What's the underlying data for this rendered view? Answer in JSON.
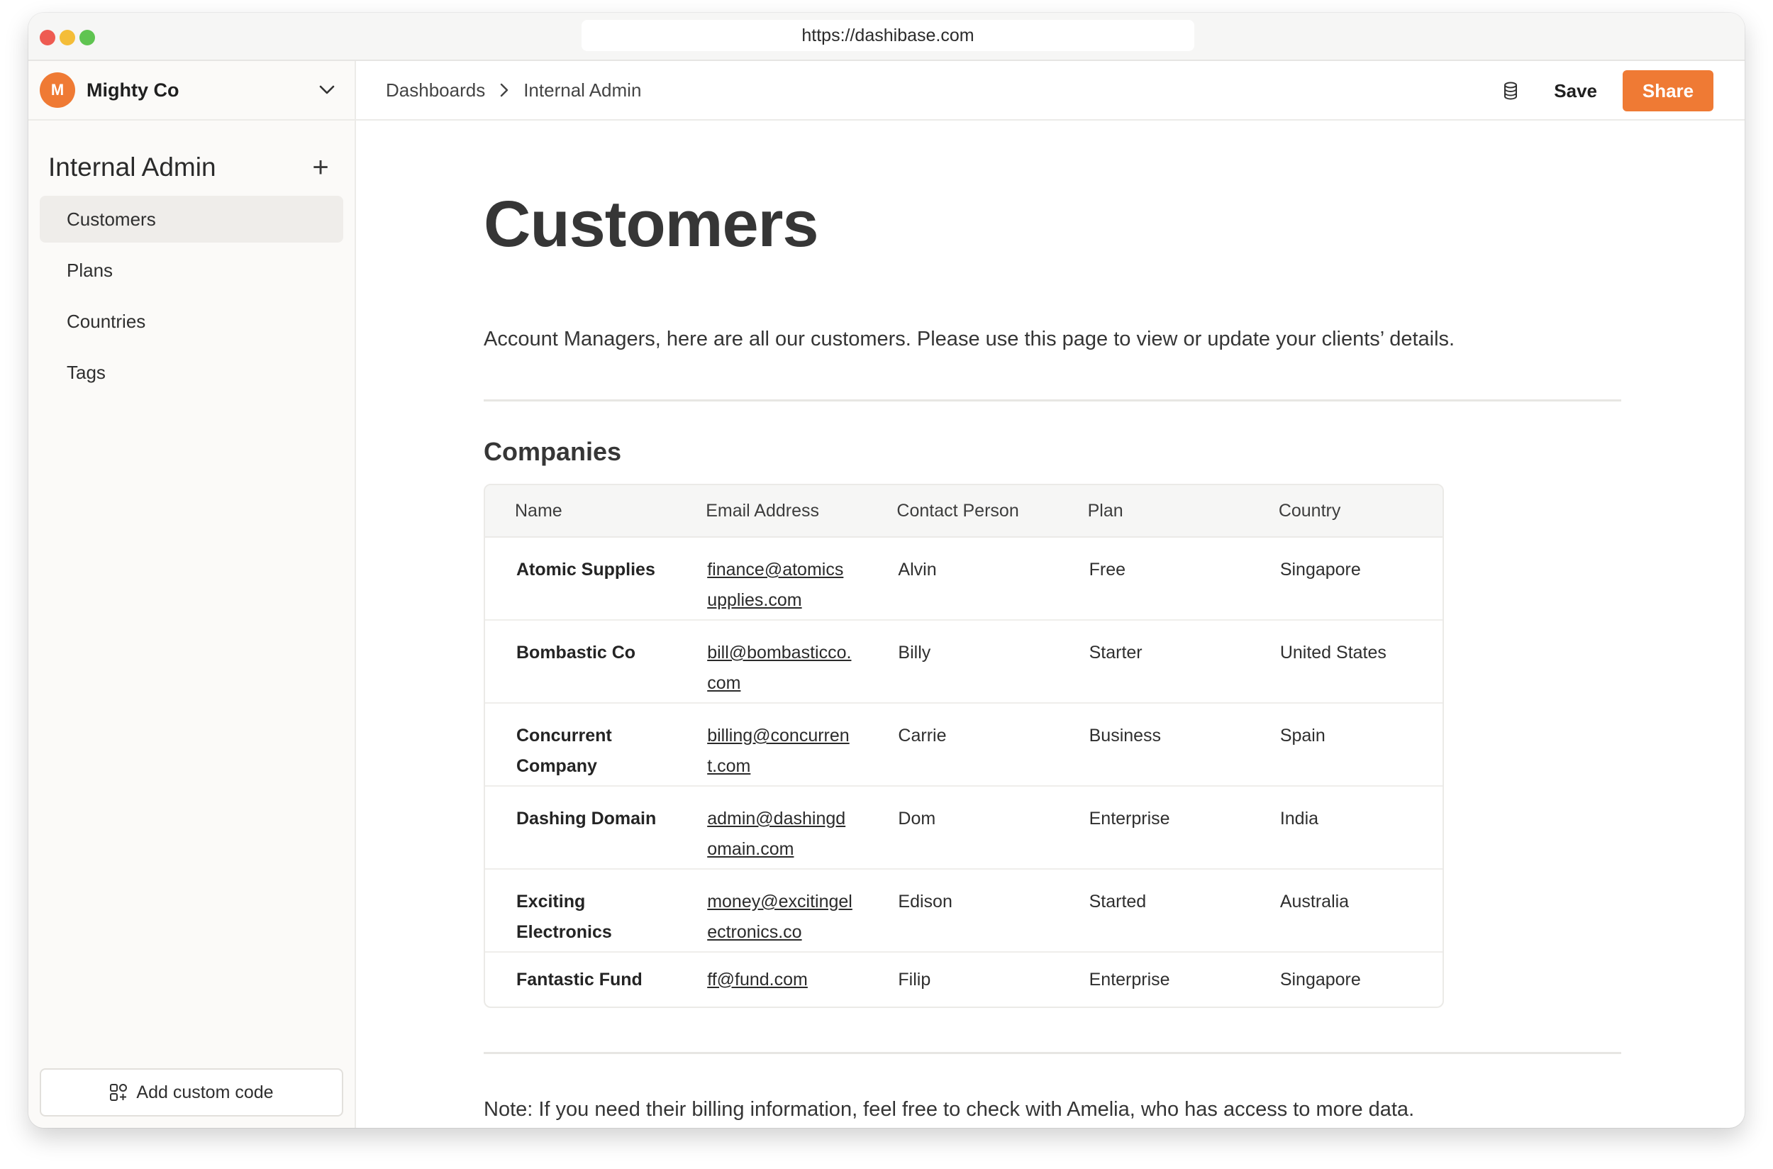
{
  "browser": {
    "url": "https://dashibase.com"
  },
  "workspace": {
    "avatar_letter": "M",
    "name": "Mighty Co",
    "accent": "#ef7a34"
  },
  "sidebar": {
    "title": "Internal Admin",
    "items": [
      {
        "label": "Customers",
        "active": true
      },
      {
        "label": "Plans",
        "active": false
      },
      {
        "label": "Countries",
        "active": false
      },
      {
        "label": "Tags",
        "active": false
      }
    ],
    "add_code_label": "Add custom code"
  },
  "topbar": {
    "breadcrumb": [
      "Dashboards",
      "Internal Admin"
    ],
    "save_label": "Save",
    "share_label": "Share"
  },
  "main": {
    "title": "Customers",
    "intro": "Account Managers, here are all our customers. Please use this page to view or update your clients’ details.",
    "section_title": "Companies",
    "note": "Note: If you need their billing information, feel free to check with Amelia, who has access to more data."
  },
  "table": {
    "columns": [
      "Name",
      "Email Address",
      "Contact Person",
      "Plan",
      "Country"
    ],
    "rows": [
      {
        "name": "Atomic Supplies",
        "email": "finance@atomicsupplies.com",
        "contact": "Alvin",
        "plan": "Free",
        "country": "Singapore"
      },
      {
        "name": "Bombastic Co",
        "email": "bill@bombasticco.com",
        "contact": "Billy",
        "plan": "Starter",
        "country": "United States"
      },
      {
        "name": "Concurrent Company",
        "email": "billing@concurrent.com",
        "contact": "Carrie",
        "plan": "Business",
        "country": "Spain"
      },
      {
        "name": "Dashing Domain",
        "email": "admin@dashingdomain.com",
        "contact": "Dom",
        "plan": "Enterprise",
        "country": "India"
      },
      {
        "name": "Exciting Electronics",
        "email": "money@excitingelectronics.co",
        "contact": "Edison",
        "plan": "Started",
        "country": "Australia"
      },
      {
        "name": "Fantastic Fund",
        "email": "ff@fund.com",
        "contact": "Filip",
        "plan": "Enterprise",
        "country": "Singapore"
      }
    ]
  },
  "icons": {
    "window_controls": [
      "close-dot",
      "minimize-dot",
      "zoom-dot"
    ],
    "workspace_chevron": "chevron-down-icon",
    "sidebar_add": "plus-icon",
    "breadcrumb_separator": "chevron-right-icon",
    "topbar_database": "database-icon",
    "add_code": "code-blocks-icon"
  }
}
